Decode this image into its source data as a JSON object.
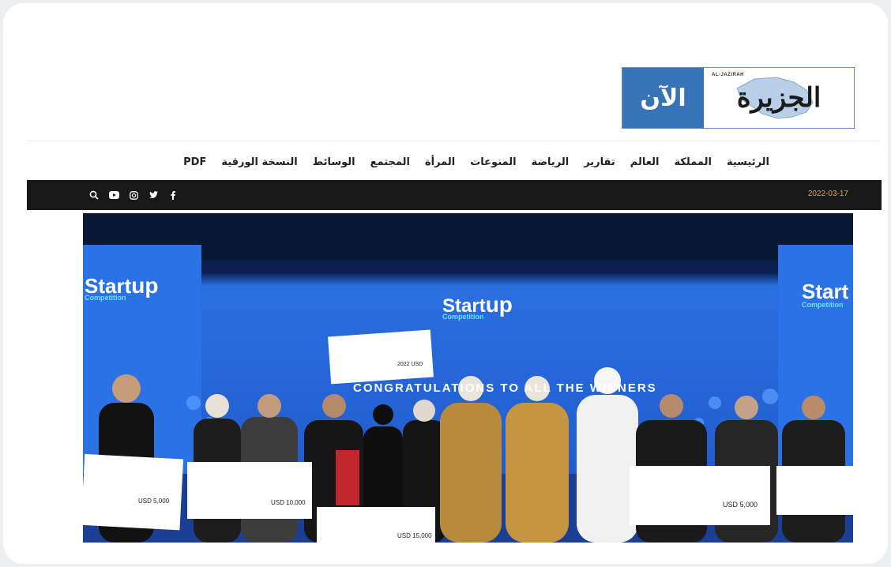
{
  "logo": {
    "name": "الجزيرة",
    "now": "الآن",
    "latin": "AL-JAZIRAH"
  },
  "nav": {
    "items": [
      {
        "label": "الرئيسية"
      },
      {
        "label": "المملكة"
      },
      {
        "label": "العالم"
      },
      {
        "label": "تقارير"
      },
      {
        "label": "الرياضة"
      },
      {
        "label": "المنوعات"
      },
      {
        "label": "المرأة"
      },
      {
        "label": "المجتمع"
      },
      {
        "label": "الوسائط"
      },
      {
        "label": "النسخة الورقية"
      },
      {
        "label": "PDF"
      }
    ]
  },
  "topbar": {
    "date": "2022-03-17",
    "social": [
      "search-icon",
      "youtube-icon",
      "instagram-icon",
      "twitter-icon",
      "facebook-icon"
    ]
  },
  "hero": {
    "screen_brand": "Start",
    "screen_brand_2": "up",
    "screen_sub": "Competition",
    "banner": "CONGRATULATIONS TO ALL THE WINNERS",
    "check_small": "USD 5,000",
    "check_mid": "USD 10,000",
    "check_front": "USD 15,000",
    "check_right": "USD 5,000",
    "check_top": "2022 USD"
  },
  "colors": {
    "accent": "#3973b7",
    "date": "#e8a23a",
    "bar": "#181818"
  }
}
